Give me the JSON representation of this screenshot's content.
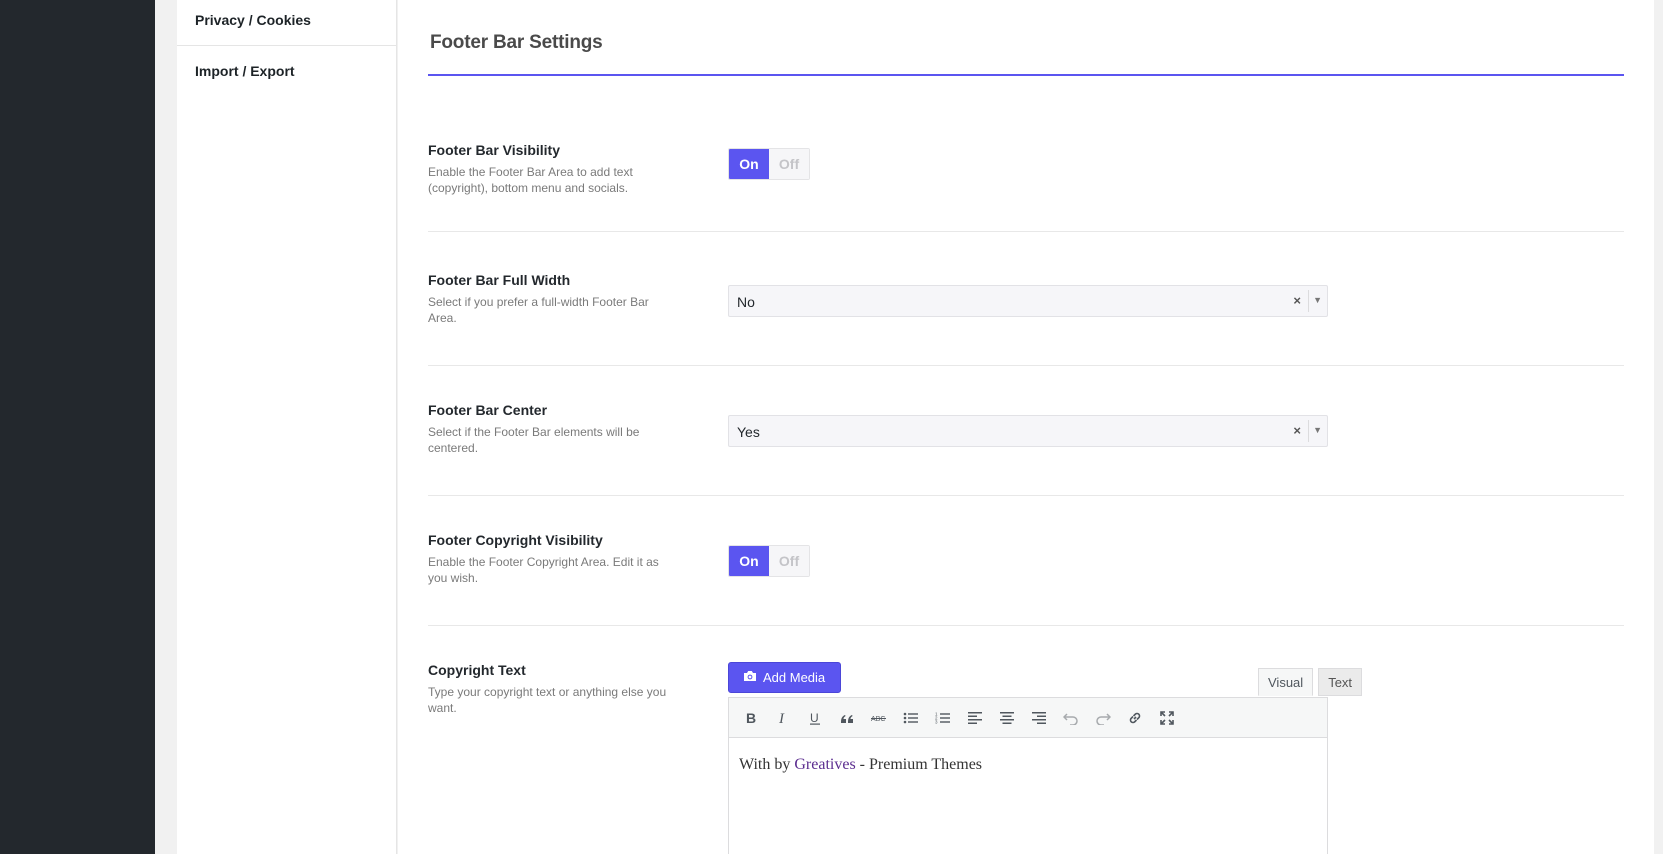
{
  "nav": {
    "items": [
      {
        "label": "Privacy / Cookies"
      },
      {
        "label": "Import / Export"
      }
    ]
  },
  "section": {
    "title": "Footer Bar Settings"
  },
  "settings": {
    "visibility": {
      "title": "Footer Bar Visibility",
      "desc": "Enable the Footer Bar Area to add text (copyright), bottom menu and socials.",
      "on_label": "On",
      "off_label": "Off",
      "value": "On"
    },
    "full_width": {
      "title": "Footer Bar Full Width",
      "desc": "Select if you prefer a full-width Footer Bar Area.",
      "value": "No",
      "clear": "×",
      "arrow": "▼"
    },
    "center": {
      "title": "Footer Bar Center",
      "desc": "Select if the Footer Bar elements will be centered.",
      "value": "Yes",
      "clear": "×",
      "arrow": "▼"
    },
    "copyright_visibility": {
      "title": "Footer Copyright Visibility",
      "desc": "Enable the Footer Copyright Area. Edit it as you wish.",
      "on_label": "On",
      "off_label": "Off",
      "value": "On"
    },
    "copyright_text": {
      "title": "Copyright Text",
      "desc": "Type your copyright text or anything else you want.",
      "add_media_label": "Add Media",
      "tabs": [
        {
          "label": "Visual",
          "active": true
        },
        {
          "label": "Text",
          "active": false
        }
      ],
      "toolbar": [
        "bold-icon",
        "italic-icon",
        "underline-icon",
        "blockquote-icon",
        "strikethrough-icon",
        "bullet-list-icon",
        "numbered-list-icon",
        "align-left-icon",
        "align-center-icon",
        "align-right-icon",
        "undo-icon",
        "redo-icon",
        "link-icon",
        "fullscreen-icon"
      ],
      "content": {
        "before": "With by ",
        "link": "Greatives",
        "after": " - Premium Themes"
      }
    }
  },
  "colors": {
    "accent": "#5b55f0",
    "sidebar_dark": "#23282d",
    "link": "#5b2c8f"
  }
}
